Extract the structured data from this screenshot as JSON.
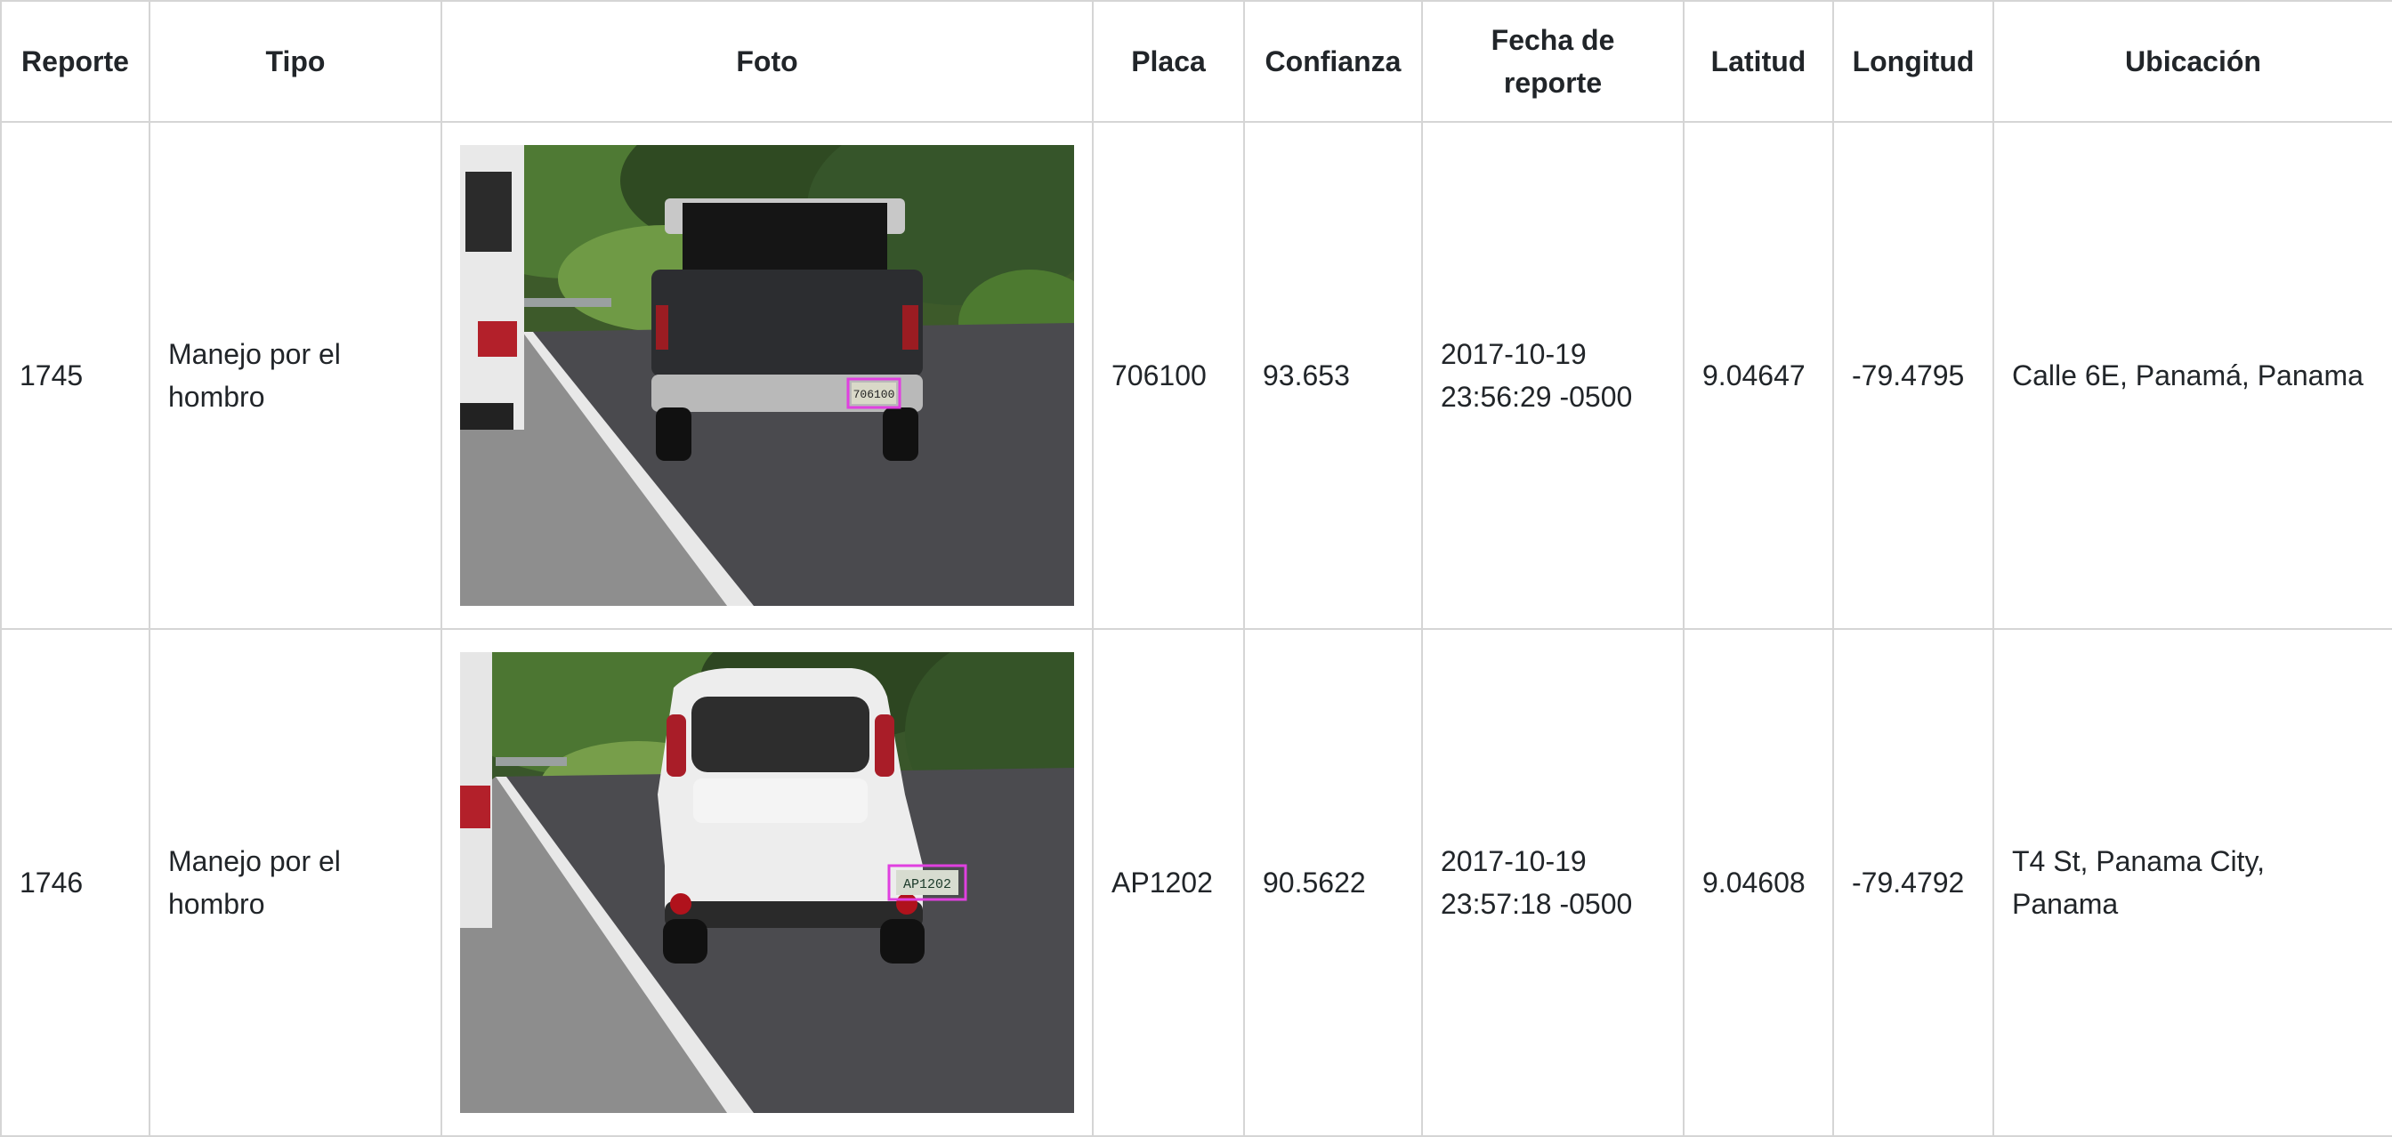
{
  "table": {
    "headers": {
      "reporte": "Reporte",
      "tipo": "Tipo",
      "foto": "Foto",
      "placa": "Placa",
      "confianza": "Confianza",
      "fecha": "Fecha de reporte",
      "latitud": "Latitud",
      "longitud": "Longitud",
      "ubicacion": "Ubicación"
    },
    "rows": [
      {
        "reporte": "1745",
        "tipo": "Manejo por el hombro",
        "photo_plate": "706100",
        "placa": "706100",
        "confianza": "93.653",
        "fecha_date": "2017-10-19",
        "fecha_time": "23:56:29 -0500",
        "latitud": "9.04647",
        "longitud": "-79.4795",
        "ubicacion": "Calle 6E, Panamá, Panama"
      },
      {
        "reporte": "1746",
        "tipo": "Manejo por el hombro",
        "photo_plate": "AP1202",
        "placa": "AP1202",
        "confianza": "90.5622",
        "fecha_date": "2017-10-19",
        "fecha_time": "23:57:18 -0500",
        "latitud": "9.04608",
        "longitud": "-79.4792",
        "ubicacion": "T4 St, Panama City, Panama"
      }
    ]
  },
  "colors": {
    "border": "#d5d5d5",
    "plate_highlight": "#e040e0"
  },
  "icons": {
    "photo_1745": "pickup-truck-photo",
    "photo_1746": "white-hatchback-photo"
  }
}
